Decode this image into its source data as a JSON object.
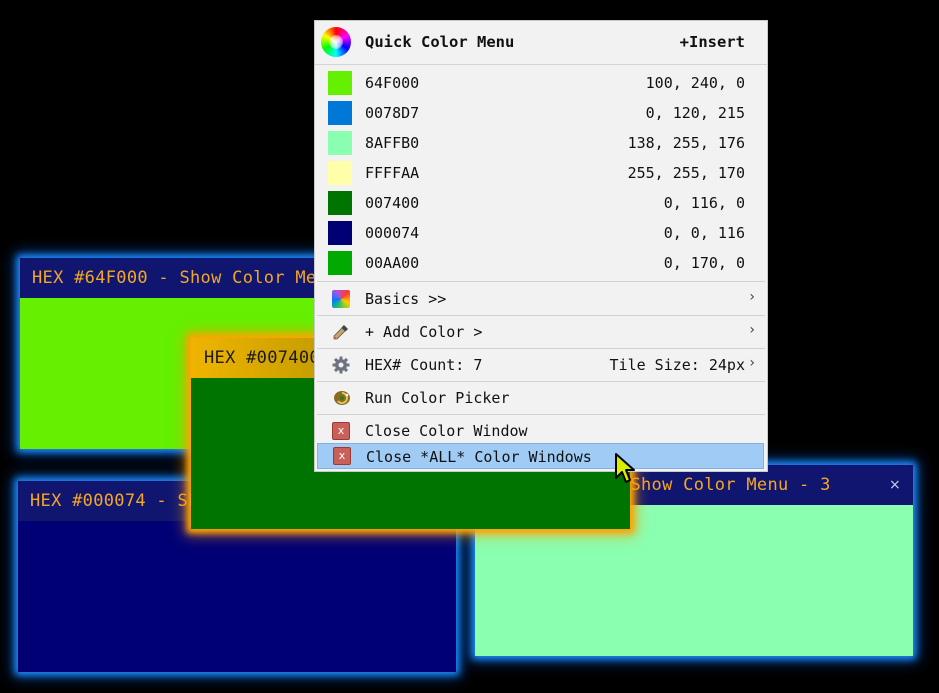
{
  "windows": {
    "win1": {
      "title": "HEX #64F000 - Show Color Menu - 1",
      "color": "#64F000",
      "bar_color": "#10166F",
      "title_color": "#F5A623",
      "glow": "#1F8FFF"
    },
    "win2": {
      "title": "HEX #000074 - Show Color Menu - 2",
      "color": "#000074"
    },
    "win3": {
      "title": "HEX #007400 - Show Color Menu - 4",
      "color": "#007400",
      "glow": "#FFA400"
    },
    "win4": {
      "title": "HEX #8AFFB0 - Show Color Menu - 3",
      "color": "#8AFFB0",
      "close": "×"
    }
  },
  "menu": {
    "title": "Quick Color Menu",
    "insert": "+Insert",
    "colors": [
      {
        "hex": "64F000",
        "rgb": "100, 240, 0",
        "swatch": "#64F000"
      },
      {
        "hex": "0078D7",
        "rgb": "0, 120, 215",
        "swatch": "#0078D7"
      },
      {
        "hex": "8AFFB0",
        "rgb": "138, 255, 176",
        "swatch": "#8AFFB0"
      },
      {
        "hex": "FFFFAA",
        "rgb": "255, 255, 170",
        "swatch": "#FFFFAA"
      },
      {
        "hex": "007400",
        "rgb": "0, 116, 0",
        "swatch": "#007400"
      },
      {
        "hex": "000074",
        "rgb": "0, 0, 116",
        "swatch": "#000074"
      },
      {
        "hex": "00AA00",
        "rgb": "0, 170, 0",
        "swatch": "#00AA00"
      }
    ],
    "basics": "Basics >>",
    "add_color": "+ Add Color >",
    "count": "HEX# Count: 7",
    "tile_size": "Tile Size: 24px",
    "run_picker": "Run Color Picker",
    "close_window": "Close Color Window",
    "close_all": "Close *ALL* Color Windows",
    "highlight_color": "#9FCBF5",
    "submenu_chevron": "›",
    "close_glyph": "x"
  },
  "icons": {
    "color-wheel": "color-wheel-icon",
    "basics": "palette-icon",
    "add": "eyedropper-icon",
    "settings": "gear-icon",
    "picker": "chameleon-icon",
    "close": "close-box-icon"
  }
}
